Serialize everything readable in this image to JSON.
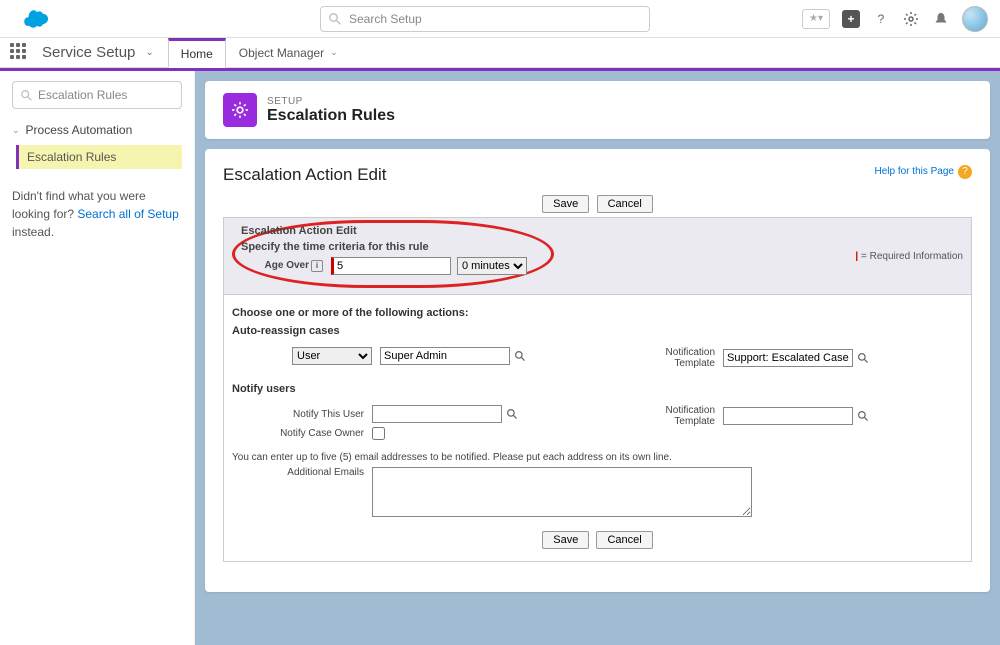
{
  "header": {
    "search_placeholder": "Search Setup",
    "app_name": "Service Setup",
    "tabs": [
      {
        "label": "Home",
        "active": true
      },
      {
        "label": "Object Manager",
        "active": false
      }
    ]
  },
  "sidebar": {
    "filter_value": "Escalation Rules",
    "tree_header": "Process Automation",
    "tree_item": "Escalation Rules",
    "nohit_pre": "Didn't find what you were looking for? ",
    "nohit_link": "Search all of Setup",
    "nohit_post": " instead."
  },
  "setup_header": {
    "small": "SETUP",
    "big": "Escalation Rules"
  },
  "page": {
    "title": "Escalation Action Edit",
    "help_label": "Help for this Page",
    "buttons": {
      "save": "Save",
      "cancel": "Cancel"
    },
    "section_title": "Escalation Action Edit",
    "required_info": "= Required Information",
    "time_criteria_label": "Specify the time criteria for this rule",
    "age_over_label": "Age Over",
    "age_over_value": "5",
    "age_over_unit": "0 minutes",
    "choose_actions_label": "Choose one or more of the following actions:",
    "auto_reassign_label": "Auto-reassign cases",
    "user_type": "User",
    "user_value": "Super Admin",
    "notif_template_label": "Notification Template",
    "notif_template_value": "Support: Escalated Case No",
    "notify_users_label": "Notify users",
    "notify_this_user_label": "Notify This User",
    "notify_this_user_value": "",
    "notif_template2_value": "",
    "notify_case_owner_label": "Notify Case Owner",
    "emails_note": "You can enter up to five (5) email addresses to be notified. Please put each address on its own line.",
    "additional_emails_label": "Additional Emails",
    "additional_emails_value": ""
  }
}
